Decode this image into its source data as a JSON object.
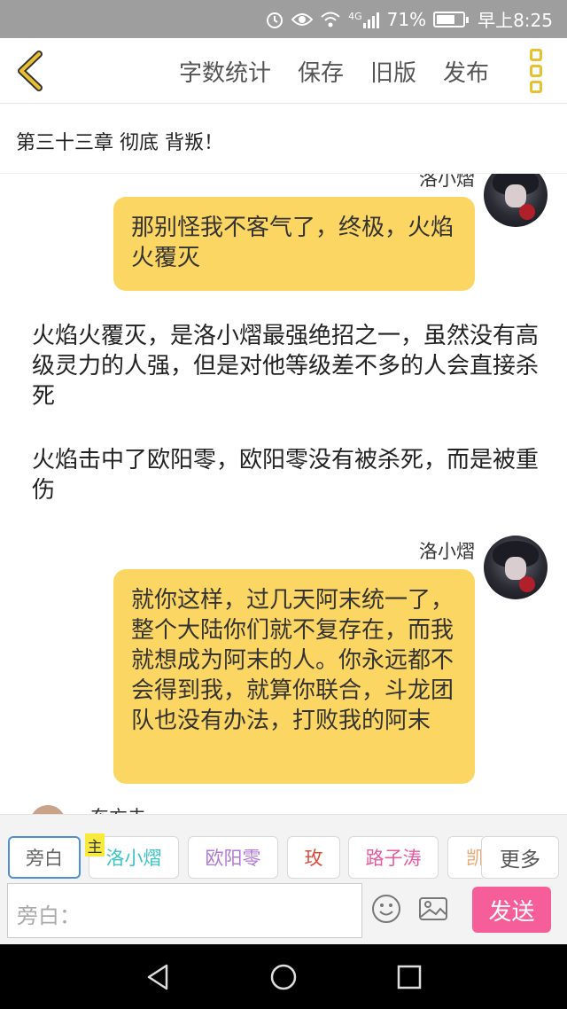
{
  "status_bar": {
    "signal_label": "4G",
    "battery_text": "71%",
    "battery_level": 0.71,
    "time": "早上8:25",
    "icons": [
      "alarm-icon",
      "eye-icon",
      "wifi-icon",
      "signal-icon",
      "battery-icon"
    ]
  },
  "toolbar": {
    "word_count": "字数统计",
    "save": "保存",
    "old_version": "旧版",
    "publish": "发布",
    "accent": "#e8c030"
  },
  "chapter": {
    "title": "第三十三章 彻底 背叛！"
  },
  "messages": [
    {
      "name": "洛小熠",
      "text": "那别怪我不客气了，终极，火焰火覆灭"
    },
    {
      "narration": "火焰火覆灭，是洛小熠最强绝招之一，虽然没有高级灵力的人强，但是对他等级差不多的人会直接杀死"
    },
    {
      "narration": "火焰击中了欧阳零，欧阳零没有被杀死，而是被重伤"
    },
    {
      "name": "洛小熠",
      "text": "就你这样，过几天阿末统一了，整个大陆你们就不复存在，而我就想成为阿末的人。你永远都不会得到我，就算你联合，斗龙团队也没有办法，打败我的阿末"
    }
  ],
  "peek_name": "东方未",
  "characters": {
    "host_tag": "主",
    "items": [
      {
        "label": "旁白",
        "color": "#666666"
      },
      {
        "label": "洛小熠",
        "color": "#3cc4c4"
      },
      {
        "label": "欧阳零",
        "color": "#b07ad6"
      },
      {
        "label": "玫",
        "color": "#e04a3a"
      },
      {
        "label": "路子涛",
        "color": "#e85aa0"
      },
      {
        "label": "凯",
        "color": "#e8a870"
      }
    ],
    "more": "更多"
  },
  "input": {
    "placeholder": "旁白："
  },
  "send_label": "发送",
  "send_color": "#f55e98",
  "bubble_color": "#fcd663"
}
